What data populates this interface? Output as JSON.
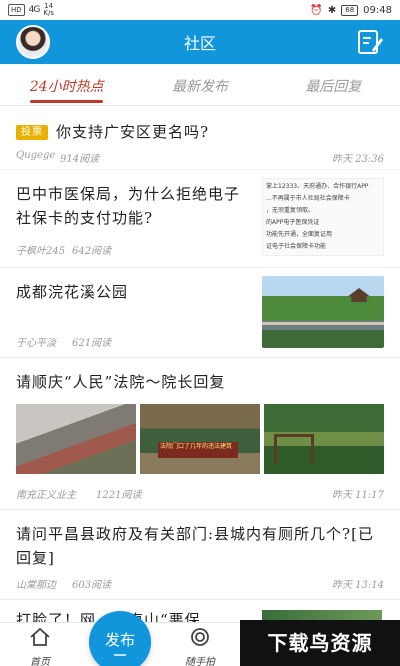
{
  "status_bar": {
    "network_badge": "HD",
    "signal": "4G",
    "speed_value": "14",
    "speed_unit": "K/s",
    "battery": "68",
    "time": "09:48"
  },
  "header": {
    "title": "社区",
    "avatar_icon": "user-avatar",
    "right_icon": "edit-note-icon",
    "bg_color": "#1296db"
  },
  "tabs": [
    {
      "label": "24小时热点",
      "active": true
    },
    {
      "label": "最新发布",
      "active": false
    },
    {
      "label": "最后回复",
      "active": false
    }
  ],
  "posts": [
    {
      "tag": "投票",
      "title": "你支持广安区更名吗?",
      "author": "Qugege",
      "views": "914阅读",
      "time": "昨天 23:36"
    },
    {
      "title": "巴中市医保局，为什么拒绝电子社保卡的支付功能?",
      "author": "子枫叶245",
      "views": "642阅读",
      "time": "",
      "thumb_text": [
        "掌上12333、天府通办、合作银行APP",
        "...不再属于市人社局社会保障卡",
        "，无须重复领取。",
        "的APP电子医保凭证",
        "功能先开通，全面复证用",
        "证电子社会保障卡功能"
      ]
    },
    {
      "title": "成都浣花溪公园",
      "author": "于心平淡",
      "views": "621阅读",
      "time": ""
    },
    {
      "title": "请顺庆“人民”法院～院长回复",
      "author": "南充正义业主",
      "views": "1221阅读",
      "time": "昨天 11:17",
      "image_caption": "法院门口了几年的违法建筑"
    },
    {
      "title": "请问平昌县政府及有关部门:县城内有厕所几个?[已回复]",
      "author": "山棠那边",
      "views": "603阅读",
      "time": "昨天 13:14"
    },
    {
      "title": "打脸了！网…刻枣山“悪保"
    }
  ],
  "bottom_nav": {
    "home": "首页",
    "publish": "发布",
    "snap": "随手拍"
  },
  "watermark": "下载鸟资源"
}
